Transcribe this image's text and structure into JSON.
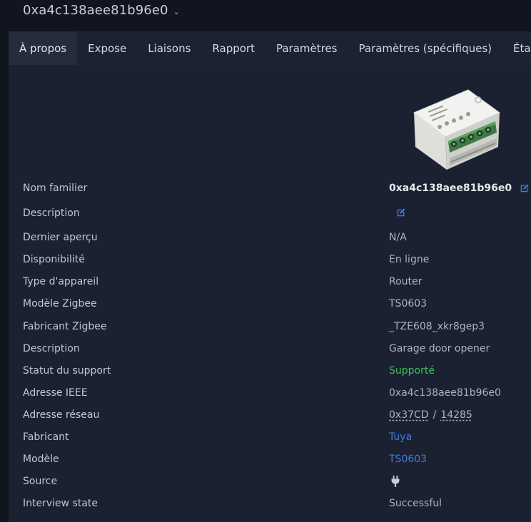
{
  "header": {
    "device_title": "0xa4c138aee81b96e0"
  },
  "tabs": [
    {
      "label": "À propos",
      "active": true
    },
    {
      "label": "Expose"
    },
    {
      "label": "Liaisons"
    },
    {
      "label": "Rapport"
    },
    {
      "label": "Paramètres"
    },
    {
      "label": "Paramètres (spécifiques)"
    },
    {
      "label": "État"
    }
  ],
  "details": {
    "friendly_name": {
      "label": "Nom familier",
      "value": "0xa4c138aee81b96e0"
    },
    "description_edit": {
      "label": "Description"
    },
    "last_seen": {
      "label": "Dernier aperçu",
      "value": "N/A"
    },
    "availability": {
      "label": "Disponibilité",
      "value": "En ligne"
    },
    "device_type": {
      "label": "Type d'appareil",
      "value": "Router"
    },
    "zigbee_model": {
      "label": "Modèle Zigbee",
      "value": "TS0603"
    },
    "zigbee_manufacturer": {
      "label": "Fabricant Zigbee",
      "value": "_TZE608_xkr8gep3"
    },
    "description": {
      "label": "Description",
      "value": "Garage door opener"
    },
    "support_status": {
      "label": "Statut du support",
      "value": "Supporté",
      "color": "#3fbf5f"
    },
    "ieee_address": {
      "label": "Adresse IEEE",
      "value": "0xa4c138aee81b96e0"
    },
    "network_address": {
      "label": "Adresse réseau",
      "hex": "0x37CD",
      "separator": "/",
      "dec": "14285"
    },
    "manufacturer": {
      "label": "Fabricant",
      "value": "Tuya"
    },
    "model": {
      "label": "Modèle",
      "value": "TS0603"
    },
    "source": {
      "label": "Source",
      "icon": "power-plug-icon"
    },
    "interview_state": {
      "label": "Interview state",
      "value": "Successful"
    }
  },
  "colors": {
    "accent": "#3d7be8",
    "success": "#3fbf5f"
  }
}
